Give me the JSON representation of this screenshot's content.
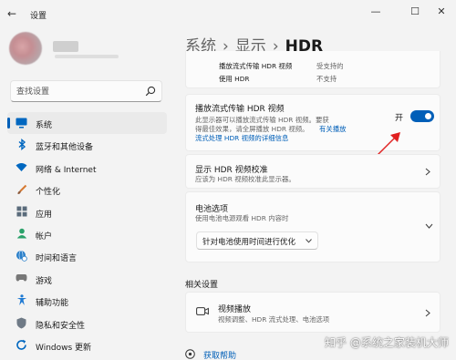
{
  "window": {
    "title": "设置",
    "back_icon": "←",
    "minimize": "—",
    "maximize": "☐",
    "close": "✕"
  },
  "search": {
    "placeholder": "查找设置"
  },
  "sidebar": {
    "items": [
      {
        "label": "系统",
        "icon": "monitor-icon",
        "color": "#0067c0",
        "active": true
      },
      {
        "label": "蓝牙和其他设备",
        "icon": "bluetooth-icon",
        "color": "#0067c0"
      },
      {
        "label": "网络 & Internet",
        "icon": "wifi-icon",
        "color": "#0067c0"
      },
      {
        "label": "个性化",
        "icon": "brush-icon",
        "color": "#d67a32"
      },
      {
        "label": "应用",
        "icon": "apps-icon",
        "color": "#5a6b7b"
      },
      {
        "label": "帐户",
        "icon": "account-icon",
        "color": "#2ba16a"
      },
      {
        "label": "时间和语言",
        "icon": "globe-clock-icon",
        "color": "#2a7fc9"
      },
      {
        "label": "游戏",
        "icon": "gamepad-icon",
        "color": "#777777"
      },
      {
        "label": "辅助功能",
        "icon": "accessibility-icon",
        "color": "#1e7ad3"
      },
      {
        "label": "隐私和安全性",
        "icon": "shield-icon",
        "color": "#6f7a86"
      },
      {
        "label": "Windows 更新",
        "icon": "update-icon",
        "color": "#0067c0"
      }
    ]
  },
  "breadcrumb": {
    "part1": "系统",
    "part2": "显示",
    "current": "HDR",
    "sep": "›"
  },
  "capabilities": {
    "rows": [
      {
        "label": "播放流式传输 HDR 视频",
        "value": "受支持的"
      },
      {
        "label": "使用 HDR",
        "value": "不支持"
      }
    ]
  },
  "streaming": {
    "title": "播放流式传输 HDR 视频",
    "desc_line1": "此显示器可以播放流式传输 HDR 视频。要获",
    "desc_line2": "得最佳效果，请全屏播放 HDR 视频。",
    "link_part1": "有关播放",
    "link_part2": "流式处理 HDR 视频的详细信息",
    "toggle_state": "开",
    "toggle_on": true
  },
  "calibration": {
    "title": "显示 HDR 视频校准",
    "desc": "应该为 HDR 视频校准此显示器。"
  },
  "battery": {
    "title": "电池选项",
    "desc": "使用电池电源观看 HDR 内容时",
    "selected": "针对电池使用时间进行优化"
  },
  "related": {
    "heading": "相关设置",
    "video": {
      "title": "视频播放",
      "desc": "视频调整、HDR 流式处理、电池选项"
    }
  },
  "help": {
    "label": "获取帮助"
  },
  "watermark": "知乎 @系统之家装机大师"
}
